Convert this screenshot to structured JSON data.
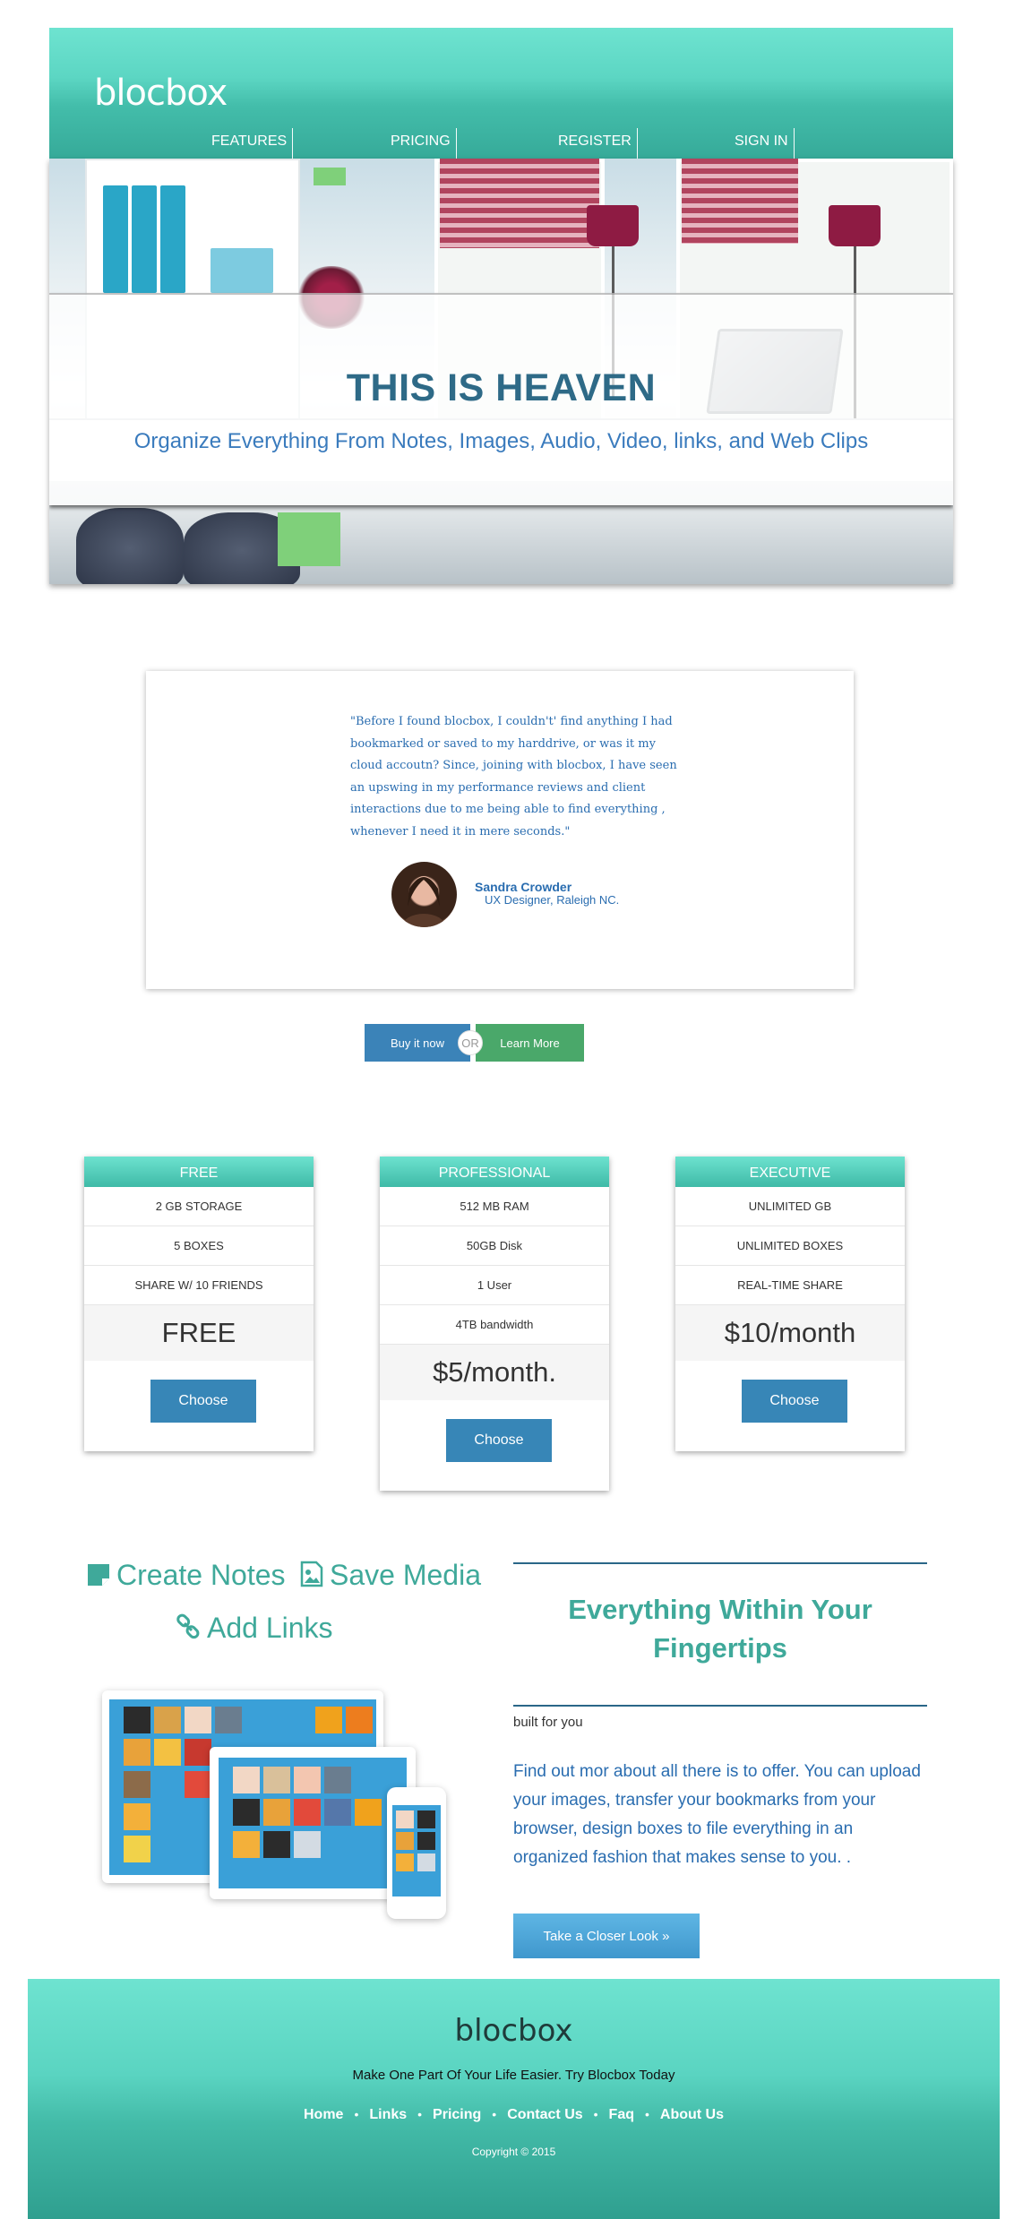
{
  "header": {
    "logo": "blocbox",
    "nav": [
      {
        "label": "FEATURES"
      },
      {
        "label": "PRICING"
      },
      {
        "label": "REGISTER"
      },
      {
        "label": "SIGN IN"
      }
    ]
  },
  "hero": {
    "title": "THIS IS HEAVEN",
    "subtitle": "Organize Everything From Notes, Images, Audio, Video, links, and Web Clips"
  },
  "testimonial": {
    "quote": "\"Before I found blocbox, I couldn't' find anything I had bookmarked or saved to my harddrive, or was it my cloud accoutn? Since, joining with blocbox, I have seen an upswing in my performance reviews and client interactions due to me being able to find everything , whenever I need it in mere seconds.\"",
    "name": "Sandra Crowder",
    "role": "UX Designer, Raleigh NC."
  },
  "cta": {
    "buy": "Buy it now",
    "or": "OR",
    "learn": "Learn More"
  },
  "plans": [
    {
      "name": "FREE",
      "features": [
        "2 GB STORAGE",
        "5 BOXES",
        "SHARE W/ 10 FRIENDS"
      ],
      "price": "FREE",
      "button": "Choose"
    },
    {
      "name": "PROFESSIONAL",
      "features": [
        "512 MB RAM",
        "50GB Disk",
        "1 User",
        "4TB bandwidth"
      ],
      "price": "$5/month.",
      "button": "Choose"
    },
    {
      "name": "EXECUTIVE",
      "features": [
        "UNLIMITED GB",
        "UNLIMITED BOXES",
        "REAL-TIME SHARE"
      ],
      "price": "$10/month",
      "button": "Choose"
    }
  ],
  "features": {
    "create_notes": "Create Notes",
    "save_media": "Save Media",
    "add_links": "Add Links",
    "side_title": "Everything Within Your Fingertips",
    "built_for": "built for you",
    "body": "Find out mor about all there is to offer. You can upload your images, transfer your bookmarks from your browser, design boxes to file everything in an organized fashion that makes sense to you. .",
    "button": "Take a Closer Look »"
  },
  "footer": {
    "logo": "blocbox",
    "tagline": "Make One Part Of Your Life Easier. Try Blocbox Today",
    "links": [
      "Home",
      "Links",
      "Pricing",
      "Contact Us",
      "Faq",
      "About Us"
    ],
    "copyright": "Copyright © 2015"
  },
  "colors": {
    "teal": "#43bdaa",
    "blue_text": "#2a6db0",
    "button_blue": "#3786b7",
    "button_green": "#4aa86a"
  }
}
